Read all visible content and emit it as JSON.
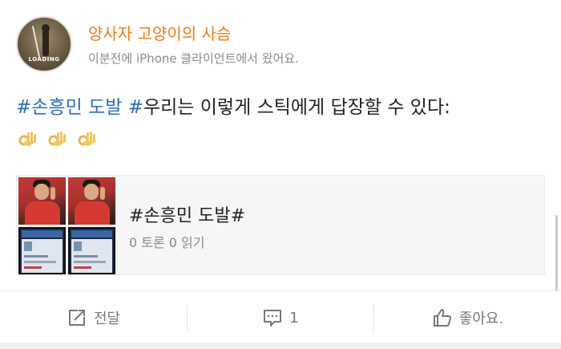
{
  "post": {
    "user_name": "양사자 고양이의 사슴",
    "meta": "이분전에 iPhone 클라이언트에서 왔어요.",
    "avatar_label": "LOADING",
    "content": {
      "hashtag1": "#손흥민 도발",
      "hashtag2": "#",
      "text": "우리는 이렇게 스틱에게 답장할 수 있다:"
    },
    "emojis": [
      "ok-hand-icon",
      "ok-hand-icon",
      "ok-hand-icon"
    ]
  },
  "card": {
    "title": "#손흥민 도발#",
    "stats": "0 토론 0 읽기"
  },
  "actions": {
    "forward_label": "전달",
    "comment_count": "1",
    "like_label": "좋아요."
  },
  "colors": {
    "username": "#eb7a1e",
    "hashtag": "#2c6cb5",
    "meta": "#8a8a8a"
  }
}
